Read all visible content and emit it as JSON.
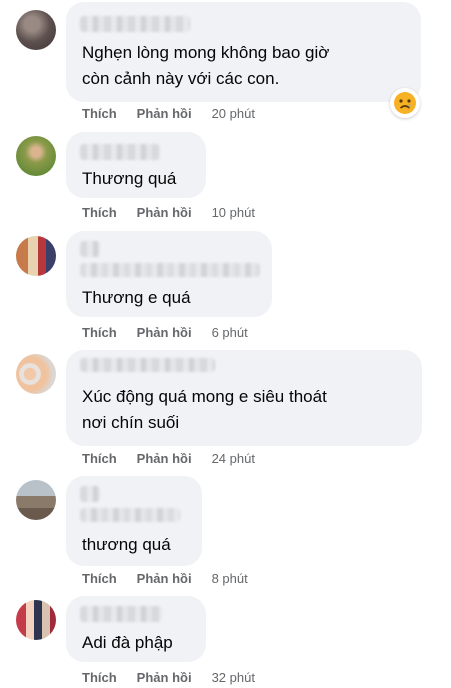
{
  "comments": [
    {
      "text": "Nghẹn lòng mong không bao giờ\ncòn cảnh này với các con.",
      "like": "Thích",
      "reply": "Phản hồi",
      "time": "20 phút",
      "reaction_icon": "sad-face-icon"
    },
    {
      "text": "Thương quá",
      "like": "Thích",
      "reply": "Phản hồi",
      "time": "10 phút"
    },
    {
      "text": "Thương e quá",
      "like": "Thích",
      "reply": "Phản hồi",
      "time": "6 phút"
    },
    {
      "text": "Xúc động quá mong e siêu thoát\nnơi chín suối",
      "like": "Thích",
      "reply": "Phản hồi",
      "time": "24 phút"
    },
    {
      "text": "thương quá",
      "like": "Thích",
      "reply": "Phản hồi",
      "time": "8 phút"
    },
    {
      "text": "Adi đà phập",
      "like": "Thích",
      "reply": "Phản hồi",
      "time": "32 phút"
    }
  ],
  "colors": {
    "bubble": "#f0f2f5",
    "meta": "#65676b",
    "text": "#050505",
    "reaction": "#f7b125"
  }
}
